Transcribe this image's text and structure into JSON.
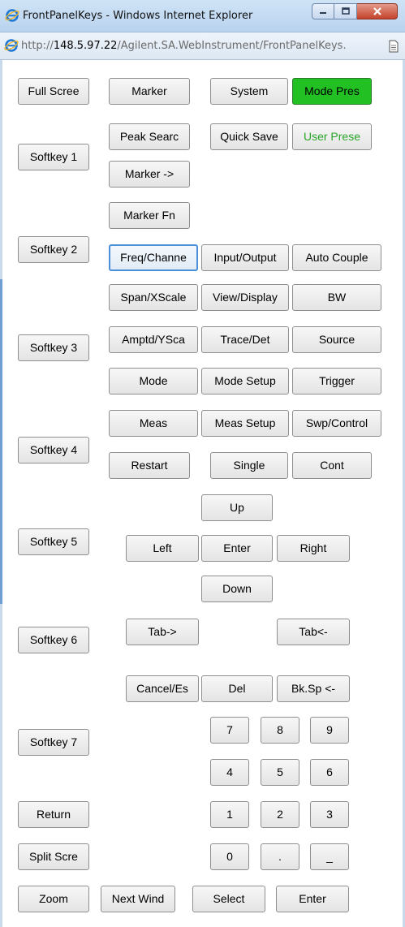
{
  "window": {
    "title": "FrontPanelKeys - Windows Internet Explorer",
    "url_prefix": "http://",
    "url_host": "148.5.97.22",
    "url_rest": "/Agilent.SA.WebInstrument/FrontPanelKeys."
  },
  "softkeys": {
    "full_screen": "Full Scree",
    "softkey1": "Softkey 1",
    "softkey2": "Softkey 2",
    "softkey3": "Softkey 3",
    "softkey4": "Softkey 4",
    "softkey5": "Softkey 5",
    "softkey6": "Softkey 6",
    "softkey7": "Softkey 7",
    "return": "Return",
    "split_screen": "Split Scre",
    "zoom": "Zoom"
  },
  "keys": {
    "marker": "Marker",
    "system": "System",
    "mode_preset": "Mode Pres",
    "peak_search": "Peak Searc",
    "quick_save": "Quick Save",
    "user_preset": "User Prese",
    "marker_to": "Marker ->",
    "marker_fn": "Marker Fn",
    "freq_channel": "Freq/Channe",
    "input_output": "Input/Output",
    "auto_couple": "Auto Couple",
    "span_xscale": "Span/XScale",
    "view_display": "View/Display",
    "bw": "BW",
    "amptd_yscale": "Amptd/YSca",
    "trace_det": "Trace/Det",
    "source": "Source",
    "mode": "Mode",
    "mode_setup": "Mode Setup",
    "trigger": "Trigger",
    "meas": "Meas",
    "meas_setup": "Meas Setup",
    "swp_control": "Swp/Control",
    "restart": "Restart",
    "single": "Single",
    "cont": "Cont",
    "up": "Up",
    "left": "Left",
    "enter_nav": "Enter",
    "right": "Right",
    "down": "Down",
    "tab_forward": "Tab->",
    "tab_back": "Tab<-",
    "cancel_esc": "Cancel/Es",
    "del": "Del",
    "backspace": "Bk.Sp <-",
    "next_window": "Next Wind",
    "select": "Select",
    "enter": "Enter"
  },
  "numpad": {
    "n7": "7",
    "n8": "8",
    "n9": "9",
    "n4": "4",
    "n5": "5",
    "n6": "6",
    "n1": "1",
    "n2": "2",
    "n3": "3",
    "n0": "0",
    "dot": ".",
    "minus": "_"
  },
  "colors": {
    "mode_preset_bg": "#22c022",
    "user_preset_text": "#2aa52a",
    "focus_border": "#4a8fd8"
  },
  "icons": {
    "browser": "ie-icon",
    "page": "page-icon",
    "minimize": "minimize-icon",
    "maximize": "maximize-icon",
    "close": "close-icon"
  }
}
